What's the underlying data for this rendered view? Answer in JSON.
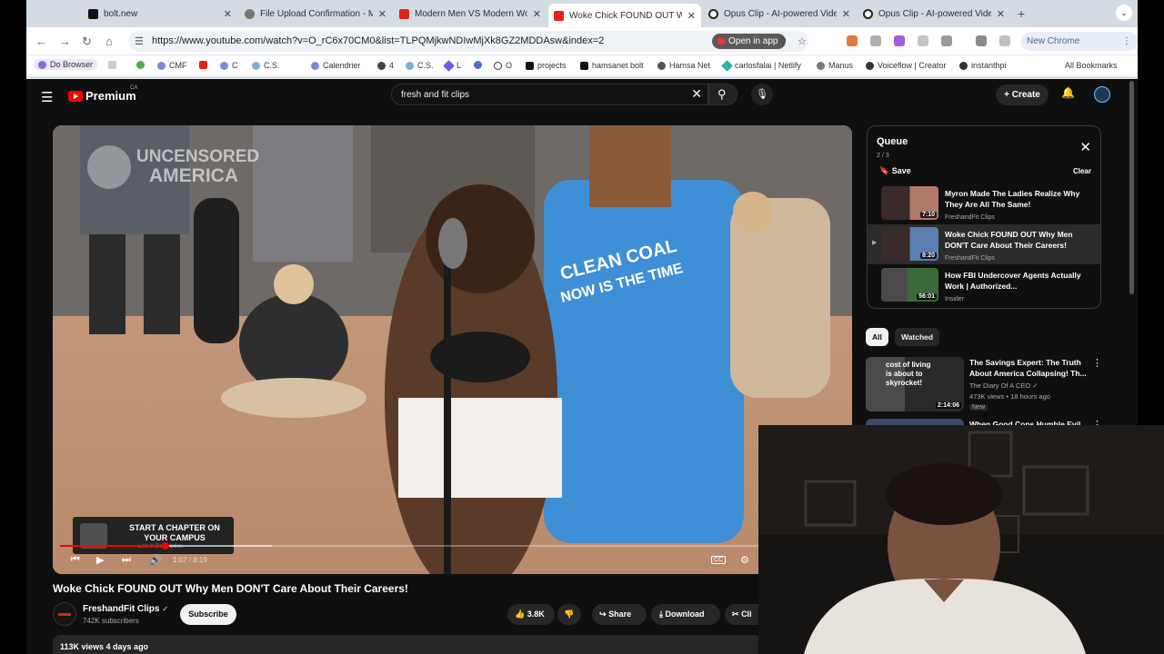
{
  "browser": {
    "tabs": [
      {
        "title": "bolt.new",
        "color": "#111111",
        "active": false
      },
      {
        "title": "File Upload Confirmation - Ma",
        "color": "#666666",
        "active": false
      },
      {
        "title": "Modern Men VS Modern Wom",
        "color": "#e62117",
        "active": false
      },
      {
        "title": "Woke Chick FOUND OUT Wh",
        "color": "#e62117",
        "active": true
      },
      {
        "title": "Opus Clip - AI-powered Video",
        "color": "#222222",
        "active": false
      },
      {
        "title": "Opus Clip - AI-powered Video",
        "color": "#222222",
        "active": false
      }
    ],
    "url": "https://www.youtube.com/watch?v=O_rC6x70CM0&list=TLPQMjkwNDIwMjXk8GZ2MDDAsw&index=2",
    "open_in_app": "Open in app",
    "new_chrome": "New Chrome available",
    "bookmarks": [
      {
        "label": "Do Browser",
        "color": "#8a6cd1"
      },
      {
        "label": "",
        "color": "#4caf50"
      },
      {
        "label": "CMF",
        "color": "#7a8ad6"
      },
      {
        "label": "",
        "color": "#e62117"
      },
      {
        "label": "C",
        "color": "#7a8ad6"
      },
      {
        "label": "C.S.",
        "color": "#7ab0d6"
      },
      {
        "label": "Calendrier",
        "color": "#7a8ad6"
      },
      {
        "label": "4",
        "color": "#444444"
      },
      {
        "label": "C.S.",
        "color": "#7ab0d6"
      },
      {
        "label": "L",
        "color": "#6c5ce7"
      },
      {
        "label": "",
        "color": "#4a6cd4"
      },
      {
        "label": "O",
        "color": "#333333"
      },
      {
        "label": "projects",
        "color": "#111111"
      },
      {
        "label": "hamsanet bolt",
        "color": "#111111"
      },
      {
        "label": "Hamsa Net",
        "color": "#555555"
      },
      {
        "label": "carlosfalai | Netlify",
        "color": "#2bb3a3"
      },
      {
        "label": "Manus",
        "color": "#555555"
      },
      {
        "label": "Voiceflow | Creator",
        "color": "#333333"
      },
      {
        "label": "instanthpi",
        "color": "#333333"
      }
    ],
    "all_bookmarks": "All Bookmarks"
  },
  "youtube": {
    "logo": "Premium",
    "region": "CA",
    "search_query": "fresh and fit clips",
    "create_label": "Create",
    "video": {
      "watermark_line1": "UNCENSORED",
      "watermark_line2": "AMERICA",
      "shirt_line1": "CLEAN COAL",
      "shirt_line2": "NOW IS THE TIME",
      "chapter_card_title": "START A CHAPTER ON YOUR CAMPUS",
      "chapter_card_sub": "Link in Description",
      "time_current": "1:07",
      "time_total": "8:19",
      "time_display": "1:07 / 8:19",
      "progress": 0.134,
      "buffered": 0.27,
      "title": "Woke Chick FOUND OUT Why Men DON'T Care About Their Careers!"
    },
    "channel": {
      "name": "FreshandFit Clips",
      "subscribers": "742K subscribers",
      "subscribe_label": "Subscribe"
    },
    "actions": {
      "likes": "3.8K",
      "share": "Share",
      "download": "Download",
      "clip": "Cli"
    },
    "description": {
      "views_date": "113K views  4 days ago"
    },
    "queue": {
      "title": "Queue",
      "position": "2 / 3",
      "save": "Save",
      "clear": "Clear",
      "items": [
        {
          "title": "Myron Made The Ladies Realize Why They Are All The Same!",
          "channel": "FreshandFit Clips",
          "duration": "7:10",
          "current": false
        },
        {
          "title": "Woke Chick FOUND OUT Why Men DON'T Care About Their Careers!",
          "channel": "FreshandFit Clips",
          "duration": "8:20",
          "current": true
        },
        {
          "title": "How FBI Undercover Agents Actually Work | Authorized...",
          "channel": "Insider",
          "duration": "56:01",
          "current": false
        }
      ]
    },
    "chips": [
      "All",
      "Watched"
    ],
    "recommendations": [
      {
        "title": "The Savings Expert: The Truth About America Collapsing! Th...",
        "channel": "The Diary Of A CEO",
        "meta": "473K views • 18 hours ago",
        "badge": "New",
        "duration": "2:14:06",
        "thumb_text": "cost of living is about to skyrocket!"
      },
      {
        "title": "When Good Cops Humble Evil...",
        "channel": "",
        "meta": "",
        "badge": "",
        "duration": "",
        "thumb_text": ""
      }
    ]
  }
}
